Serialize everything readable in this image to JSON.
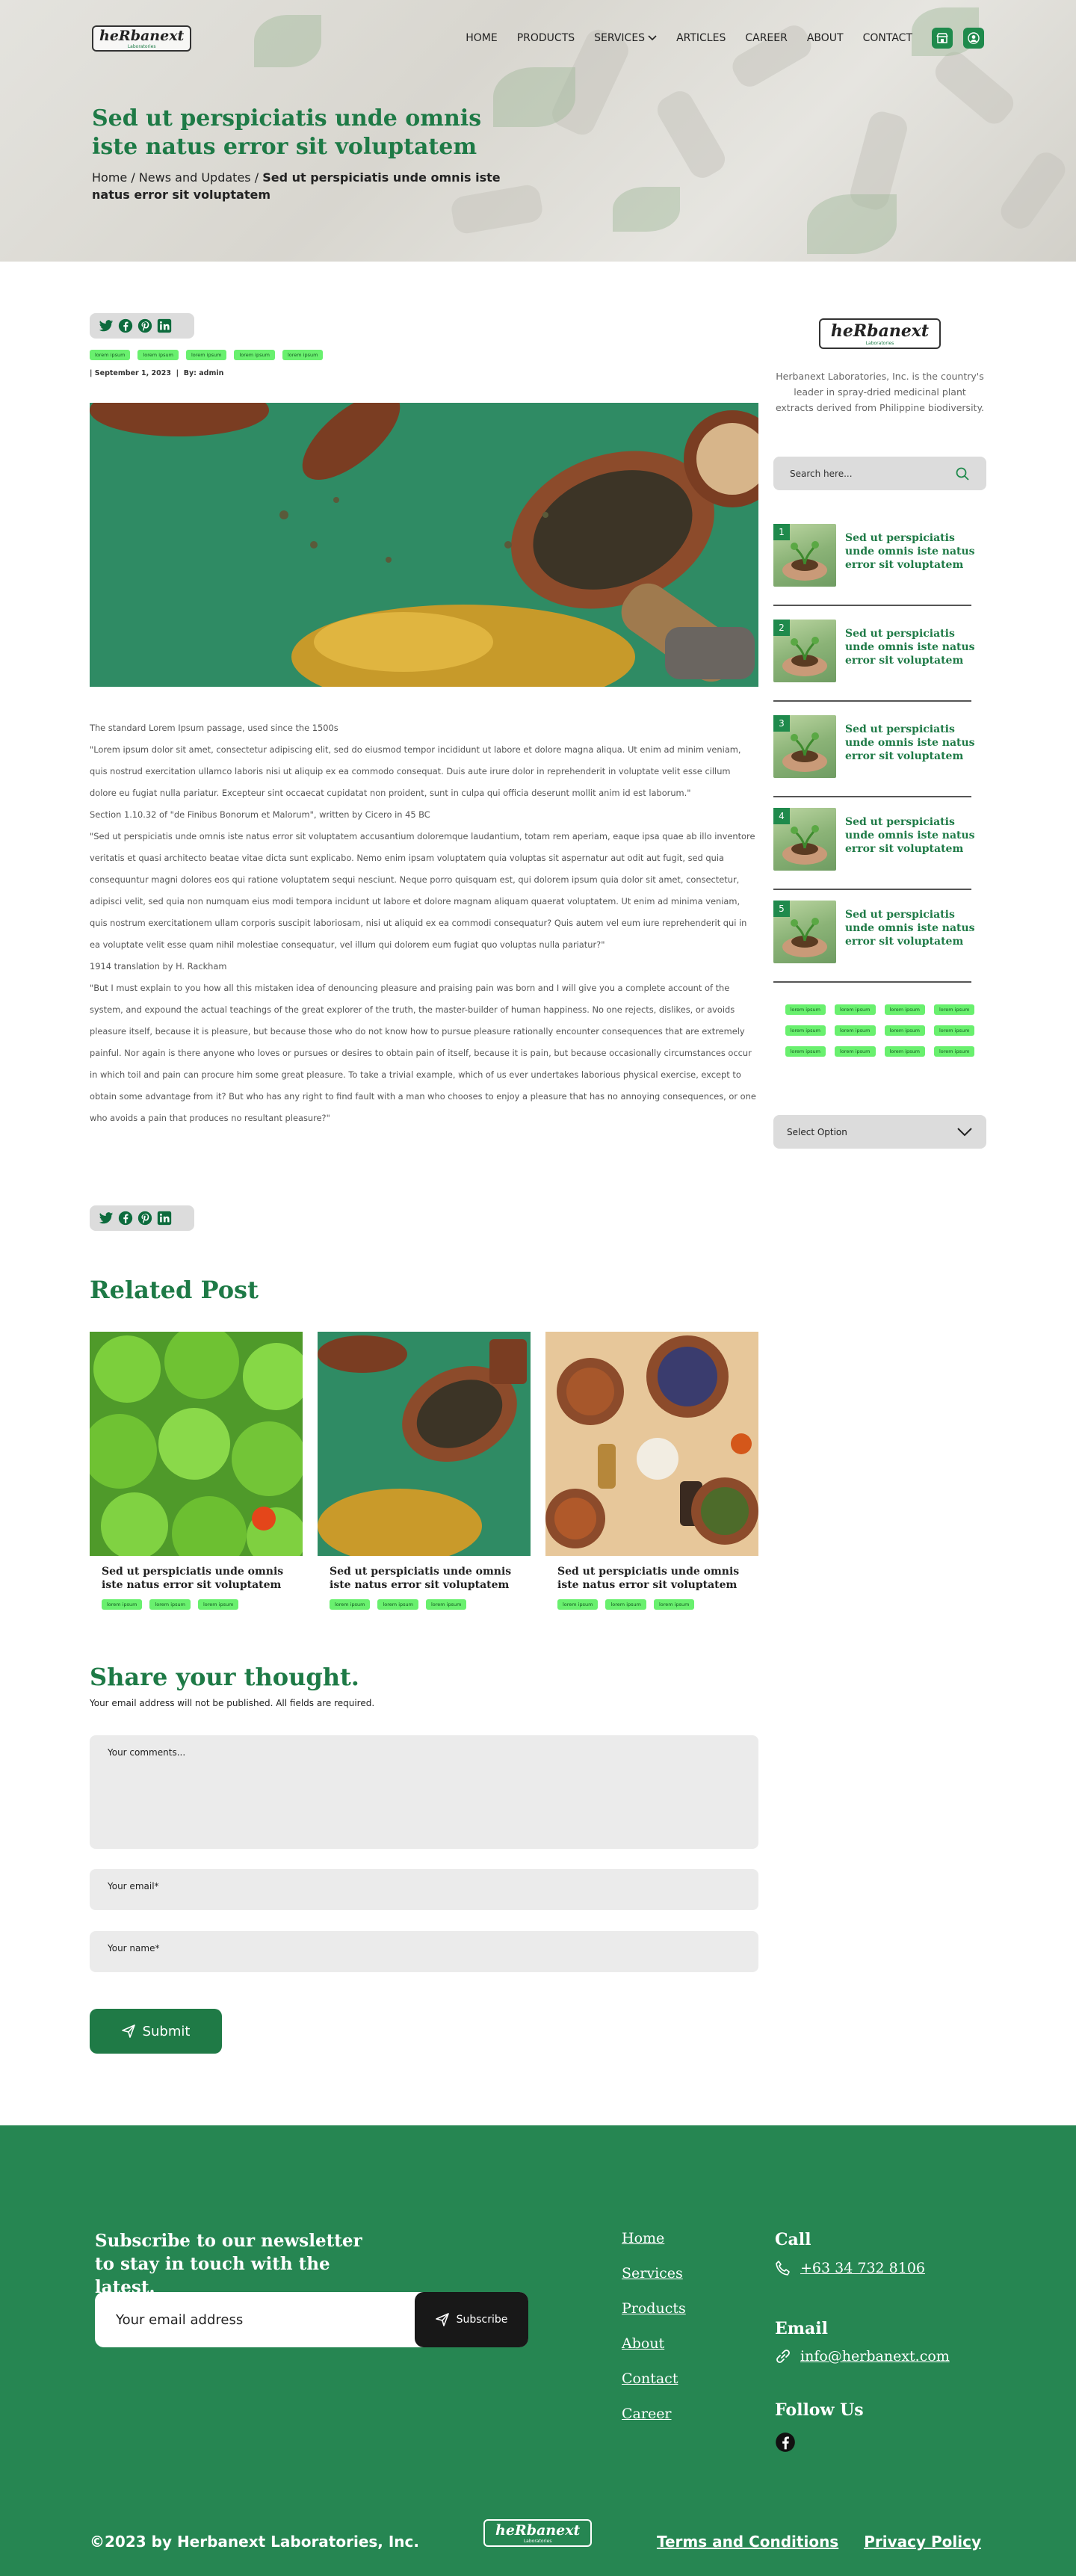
{
  "brand": {
    "logo_text": "heRbanext",
    "logo_sub": "Laboratories"
  },
  "nav": {
    "items": [
      "HOME",
      "PRODUCTS",
      "SERVICES",
      "ARTICLES",
      "CAREER",
      "ABOUT",
      "CONTACT"
    ]
  },
  "hero": {
    "title": "Sed ut perspiciatis unde omnis iste natus error sit voluptatem",
    "breadcrumb_home": "Home",
    "breadcrumb_sep": "/",
    "breadcrumb_section": "News and Updates",
    "breadcrumb_current": "Sed ut perspiciatis unde omnis iste natus error sit voluptatem"
  },
  "post": {
    "tags": [
      "lorem ipsum",
      "lorem ipsum",
      "lorem ipsum",
      "lorem ipsum",
      "lorem ipsum"
    ],
    "date": "September 1, 2023",
    "author": "By: admin",
    "paragraphs": [
      "The standard Lorem Ipsum passage, used since the 1500s",
      "\"Lorem ipsum dolor sit amet, consectetur adipiscing elit, sed do eiusmod tempor incididunt ut labore et dolore magna aliqua. Ut enim ad minim veniam, quis nostrud exercitation ullamco laboris nisi ut aliquip ex ea commodo consequat. Duis aute irure dolor in reprehenderit in voluptate velit esse cillum dolore eu fugiat nulla pariatur. Excepteur sint occaecat cupidatat non proident, sunt in culpa qui officia deserunt mollit anim id est laborum.\"",
      "Section 1.10.32 of \"de Finibus Bonorum et Malorum\", written by Cicero in 45 BC",
      "\"Sed ut perspiciatis unde omnis iste natus error sit voluptatem accusantium doloremque laudantium, totam rem aperiam, eaque ipsa quae ab illo inventore veritatis et quasi architecto beatae vitae dicta sunt explicabo. Nemo enim ipsam voluptatem quia voluptas sit aspernatur aut odit aut fugit, sed quia consequuntur magni dolores eos qui ratione voluptatem sequi nesciunt. Neque porro quisquam est, qui dolorem ipsum quia dolor sit amet, consectetur, adipisci velit, sed quia non numquam eius modi tempora incidunt ut labore et dolore magnam aliquam quaerat voluptatem. Ut enim ad minima veniam, quis nostrum exercitationem ullam corporis suscipit laboriosam, nisi ut aliquid ex ea commodi consequatur? Quis autem vel eum iure reprehenderit qui in ea voluptate velit esse quam nihil molestiae consequatur, vel illum qui dolorem eum fugiat quo voluptas nulla pariatur?\"",
      "1914 translation by H. Rackham",
      "\"But I must explain to you how all this mistaken idea of denouncing pleasure and praising pain was born and I will give you a complete account of the system, and expound the actual teachings of the great explorer of the truth, the master-builder of human happiness. No one rejects, dislikes, or avoids pleasure itself, because it is pleasure, but because those who do not know how to pursue pleasure rationally encounter consequences that are extremely painful. Nor again is there anyone who loves or pursues or desires to obtain pain of itself, because it is pain, but because occasionally circumstances occur in which toil and pain can procure him some great pleasure. To take a trivial example, which of us ever undertakes laborious physical exercise, except to obtain some advantage from it? But who has any right to find fault with a man who chooses to enjoy a pleasure that has no annoying consequences, or one who avoids a pain that produces no resultant pleasure?\""
    ]
  },
  "sidebar": {
    "about": "Herbanext Laboratories, Inc. is the country's leader in spray-dried medicinal plant extracts derived from Philippine biodiversity.",
    "search_placeholder": "Search here...",
    "recent": [
      {
        "num": "1",
        "title": "Sed ut perspiciatis unde omnis iste natus error sit voluptatem"
      },
      {
        "num": "2",
        "title": "Sed ut perspiciatis unde omnis iste natus error sit voluptatem"
      },
      {
        "num": "3",
        "title": "Sed ut perspiciatis unde omnis iste natus error sit voluptatem"
      },
      {
        "num": "4",
        "title": "Sed ut perspiciatis unde omnis iste natus error sit voluptatem"
      },
      {
        "num": "5",
        "title": "Sed ut perspiciatis unde omnis iste natus error sit voluptatem"
      }
    ],
    "tag_cloud": [
      "lorem ipsum",
      "lorem ipsum",
      "lorem ipsum",
      "lorem ipsum",
      "lorem ipsum",
      "lorem ipsum",
      "lorem ipsum",
      "lorem ipsum",
      "lorem ipsum",
      "lorem ipsum",
      "lorem ipsum",
      "lorem ipsum"
    ],
    "select_label": "Select Option"
  },
  "related": {
    "heading": "Related Post",
    "cards": [
      {
        "title": "Sed ut perspiciatis unde omnis iste natus error sit voluptatem",
        "tags": [
          "lorem ipsum",
          "lorem ipsum",
          "lorem ipsum"
        ]
      },
      {
        "title": "Sed ut perspiciatis unde omnis iste natus error sit voluptatem",
        "tags": [
          "lorem ipsum",
          "lorem ipsum",
          "lorem ipsum"
        ]
      },
      {
        "title": "Sed ut perspiciatis unde omnis iste natus error sit voluptatem",
        "tags": [
          "lorem ipsum",
          "lorem ipsum",
          "lorem ipsum"
        ]
      }
    ]
  },
  "comment_form": {
    "heading": "Share your thought.",
    "note": "Your email address will not be published. All fields are required.",
    "comment_placeholder": "Your comments...",
    "email_placeholder": "Your email*",
    "name_placeholder": "Your name*",
    "submit_label": "Submit"
  },
  "footer": {
    "newsletter_text": "Subscribe to our newsletter to stay in touch with the latest.",
    "email_placeholder": "Your email address",
    "subscribe_label": "Subscribe",
    "links": [
      "Home",
      "Services",
      "Products",
      "About",
      "Contact",
      "Career"
    ],
    "call_heading": "Call",
    "phone": "+63 34 732 8106",
    "email_heading": "Email",
    "email": "info@herbanext.com",
    "follow_heading": "Follow Us",
    "copyright": "©2023 by Herbanext Laboratories, Inc.",
    "terms": "Terms and Conditions",
    "privacy": "Privacy Policy"
  },
  "colors": {
    "brand_green": "#1f8a4c",
    "tag_green": "#69f06e",
    "footer_green": "#268652"
  }
}
